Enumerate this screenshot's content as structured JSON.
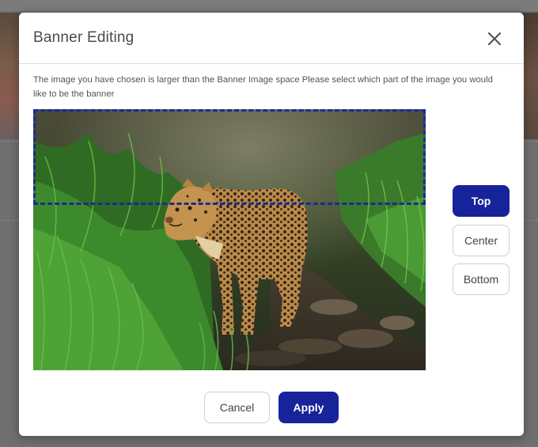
{
  "dialog": {
    "title": "Banner Editing",
    "instructions": "The image you have chosen is larger than the Banner Image space Please select which part of the image you would like to be the banner"
  },
  "image": {
    "subject": "jaguar-in-stream",
    "selected_region": "top"
  },
  "position_buttons": [
    {
      "label": "Top",
      "active": true
    },
    {
      "label": "Center",
      "active": false
    },
    {
      "label": "Bottom",
      "active": false
    }
  ],
  "footer": {
    "cancel_label": "Cancel",
    "apply_label": "Apply"
  },
  "colors": {
    "accent": "#17239a",
    "crop_frame": "#1a2a9a"
  },
  "icons": {
    "close": "close-icon"
  }
}
